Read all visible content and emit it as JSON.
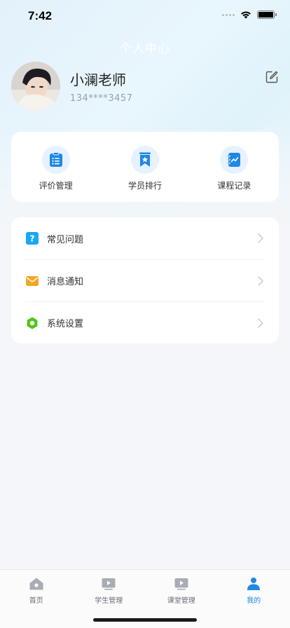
{
  "status_bar": {
    "time": "7:42"
  },
  "header": {
    "title": "个人中心"
  },
  "profile": {
    "name": "小澜老师",
    "phone": "134****3457"
  },
  "quick_actions": [
    {
      "label": "评价管理",
      "icon": "list-icon"
    },
    {
      "label": "学员排行",
      "icon": "star-bookmark-icon"
    },
    {
      "label": "课程记录",
      "icon": "chart-notebook-icon"
    }
  ],
  "menu": [
    {
      "label": "常见问题",
      "icon": "question-icon",
      "color": "#1aa7f0"
    },
    {
      "label": "消息通知",
      "icon": "mail-icon",
      "color": "#f5a623"
    },
    {
      "label": "系统设置",
      "icon": "settings-hex-icon",
      "color": "#52c41a"
    }
  ],
  "tabbar": [
    {
      "label": "首页",
      "icon": "home-icon",
      "active": false
    },
    {
      "label": "学生管理",
      "icon": "video-icon",
      "active": false
    },
    {
      "label": "课堂管理",
      "icon": "video-icon",
      "active": false
    },
    {
      "label": "我的",
      "icon": "user-icon",
      "active": true
    }
  ],
  "colors": {
    "accent": "#1e88e5",
    "icon_bg": "#e6f2fd"
  }
}
